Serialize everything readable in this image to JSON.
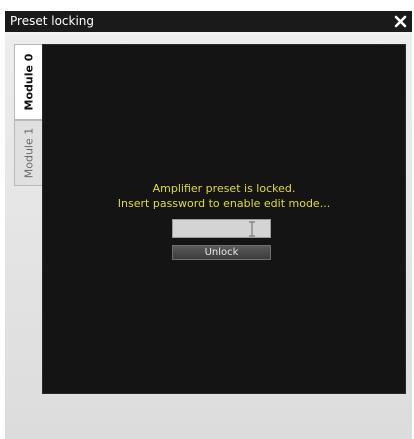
{
  "window": {
    "title": "Preset locking",
    "close_icon": "close-icon"
  },
  "tabs": [
    {
      "label": "Module 0",
      "active": true
    },
    {
      "label": "Module 1",
      "active": false
    }
  ],
  "lock_panel": {
    "message_line1": "Amplifier preset is locked.",
    "message_line2": "Insert password to enable edit mode...",
    "password": {
      "value": "",
      "placeholder": ""
    },
    "unlock_label": "Unlock"
  },
  "colors": {
    "titlebar": "#1a1a1a",
    "panel_background": "#141414",
    "message_text": "#dede2c",
    "button": "#4a4a4a"
  }
}
